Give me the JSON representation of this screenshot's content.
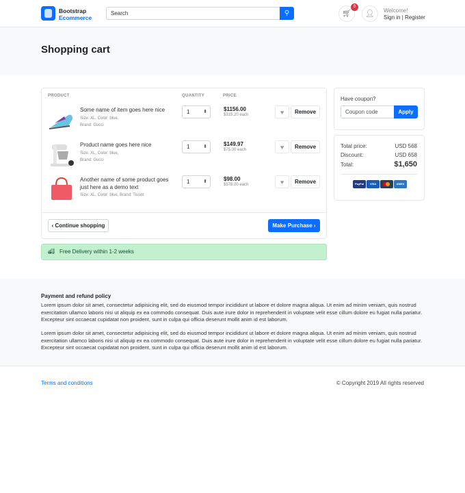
{
  "header": {
    "brand_line1": "Bootstrap",
    "brand_line2": "Ecommerce",
    "search_placeholder": "Search",
    "cart_count": "0",
    "welcome": "Welcome!",
    "sign_in": "Sign in",
    "separator": "|",
    "register": "Register"
  },
  "page_title": "Shopping cart",
  "cart": {
    "headers": {
      "product": "PRODUCT",
      "quantity": "QUANTITY",
      "price": "PRICE"
    },
    "items": [
      {
        "name": "Some name of item goes here nice",
        "meta1": "Size: XL, Color: blue,",
        "meta2": "Brand: Gucci",
        "qty": "1",
        "price": "$1156.00",
        "each": "$315.20 each",
        "remove": "Remove"
      },
      {
        "name": "Product name goes here nice",
        "meta1": "Size: XL, Color: blue,",
        "meta2": "Brand: Gucci",
        "qty": "1",
        "price": "$149.97",
        "each": "$75.00 each",
        "remove": "Remove"
      },
      {
        "name": "Another name of some product goes just here as a demo text",
        "meta1": "Size: XL, Color: blue, Brand: Tissot",
        "meta2": "",
        "qty": "1",
        "price": "$98.00",
        "each": "$578.00 each",
        "remove": "Remove"
      }
    ],
    "continue": "Continue shopping",
    "purchase": "Make Purchase"
  },
  "delivery": "Free Delivery within 1-2 weeks",
  "coupon": {
    "label": "Have coupon?",
    "placeholder": "Coupon code",
    "apply": "Apply"
  },
  "summary": {
    "total_price_label": "Total price:",
    "total_price": "USD 568",
    "discount_label": "Discount:",
    "discount": "USD 658",
    "total_label": "Total:",
    "total": "$1,650",
    "payments": [
      "PayPal",
      "VISA",
      "",
      "AMEX"
    ]
  },
  "policy": {
    "title": "Payment and refund policy",
    "p1": "Lorem ipsum dolor sit amet, consectetur adipisicing elit, sed do eiusmod tempor incididunt ut labore et dolore magna aliqua. Ut enim ad minim veniam, quis nostrud exercitation ullamco laboris nisi ut aliquip ex ea commodo consequat. Duis aute irure dolor in reprehenderit in voluptate velit esse cillum dolore eu fugiat nulla pariatur. Excepteur sint occaecat cupidatat non proident, sunt in culpa qui officia deserunt mollit anim id est laborum.",
    "p2": "Lorem ipsum dolor sit amet, consectetur adipisicing elit, sed do eiusmod tempor incididunt ut labore et dolore magna aliqua. Ut enim ad minim veniam, quis nostrud exercitation ullamco laboris nisi ut aliquip ex ea commodo consequat. Duis aute irure dolor in reprehenderit in voluptate velit esse cillum dolore eu fugiat nulla pariatur. Excepteur sint occaecat cupidatat non proident, sunt in culpa qui officia deserunt mollit anim id est laborum."
  },
  "footer": {
    "terms": "Terms and conditions",
    "copyright": "© Copyright 2019 All rights reserved"
  }
}
